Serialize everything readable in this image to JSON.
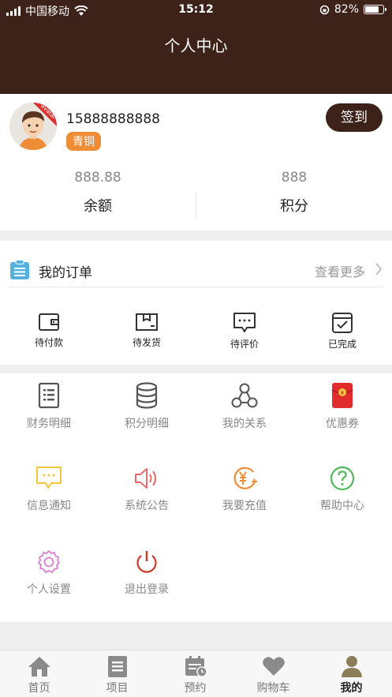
{
  "status_bar": {
    "carrier": "中国移动",
    "time": "15:12",
    "battery": "82%",
    "battery_level": 0.82
  },
  "header": {
    "title": "个人中心"
  },
  "profile": {
    "phone": "15888888888",
    "level": "青铜",
    "avatar_ribbon": "avatar",
    "signin_label": "签到",
    "balance_value": "888.88",
    "balance_label": "余额",
    "points_value": "888",
    "points_label": "积分"
  },
  "orders": {
    "title": "我的订单",
    "more": "查看更多",
    "items": [
      {
        "label": "待付款",
        "icon": "wallet-icon"
      },
      {
        "label": "待发货",
        "icon": "package-icon"
      },
      {
        "label": "待评价",
        "icon": "comment-icon"
      },
      {
        "label": "已完成",
        "icon": "check-box-icon"
      }
    ]
  },
  "services": [
    {
      "label": "财务明细",
      "icon": "ledger-icon",
      "color": "#555555"
    },
    {
      "label": "积分明细",
      "icon": "database-icon",
      "color": "#555555"
    },
    {
      "label": "我的关系",
      "icon": "network-icon",
      "color": "#555555"
    },
    {
      "label": "优惠券",
      "icon": "red-envelope-icon",
      "color": "#e02c2c"
    },
    {
      "label": "信息通知",
      "icon": "message-icon",
      "color": "#f0c83a"
    },
    {
      "label": "系统公告",
      "icon": "speaker-icon",
      "color": "#e96a6a"
    },
    {
      "label": "我要充值",
      "icon": "recharge-icon",
      "color": "#ef8c36"
    },
    {
      "label": "帮助中心",
      "icon": "help-icon",
      "color": "#53b85a"
    },
    {
      "label": "个人设置",
      "icon": "gear-icon",
      "color": "#d98ad0"
    },
    {
      "label": "退出登录",
      "icon": "power-icon",
      "color": "#cc3a2c"
    }
  ],
  "tabbar": [
    {
      "label": "首页",
      "icon": "home-icon"
    },
    {
      "label": "项目",
      "icon": "list-icon"
    },
    {
      "label": "预约",
      "icon": "calendar-icon"
    },
    {
      "label": "购物车",
      "icon": "heart-icon"
    },
    {
      "label": "我的",
      "icon": "user-icon",
      "active": true
    }
  ],
  "colors": {
    "brand": "#3d2219",
    "level_badge": "#ef8c36",
    "orders_icon": "#55b1dd"
  }
}
